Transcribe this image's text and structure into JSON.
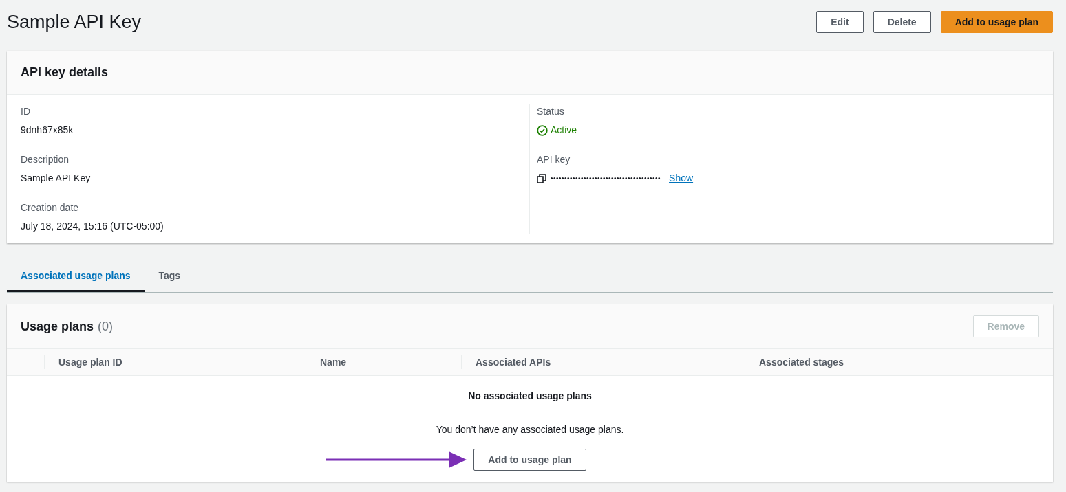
{
  "page": {
    "title": "Sample API Key",
    "actions": [
      {
        "label": "Edit",
        "kind": "normal"
      },
      {
        "label": "Delete",
        "kind": "normal"
      },
      {
        "label": "Add to usage plan",
        "kind": "primary"
      }
    ]
  },
  "details": {
    "title": "API key details",
    "left": [
      {
        "label": "ID",
        "value": "9dnh67x85k"
      },
      {
        "label": "Description",
        "value": "Sample API Key"
      },
      {
        "label": "Creation date",
        "value": "July 18, 2024, 15:16 (UTC-05:00)"
      }
    ],
    "status": {
      "label": "Status",
      "value": "Active"
    },
    "api_key": {
      "label": "API key",
      "value": "••••••••••••••••••••••••••••••••••••••••",
      "link": "Show"
    }
  },
  "tabs": [
    {
      "label": "Associated usage plans",
      "selected": true
    },
    {
      "label": "Tags",
      "selected": false
    }
  ],
  "usage_plans": {
    "title": "Usage plans",
    "count": "(0)",
    "remove": {
      "label": "Remove",
      "disabled": true
    },
    "columns": [
      "Usage plan ID",
      "Name",
      "Associated APIs",
      "Associated stages"
    ],
    "empty_title": "No associated usage plans",
    "empty_text": "You don’t have any associated usage plans.",
    "add_button": "Add to usage plan"
  }
}
